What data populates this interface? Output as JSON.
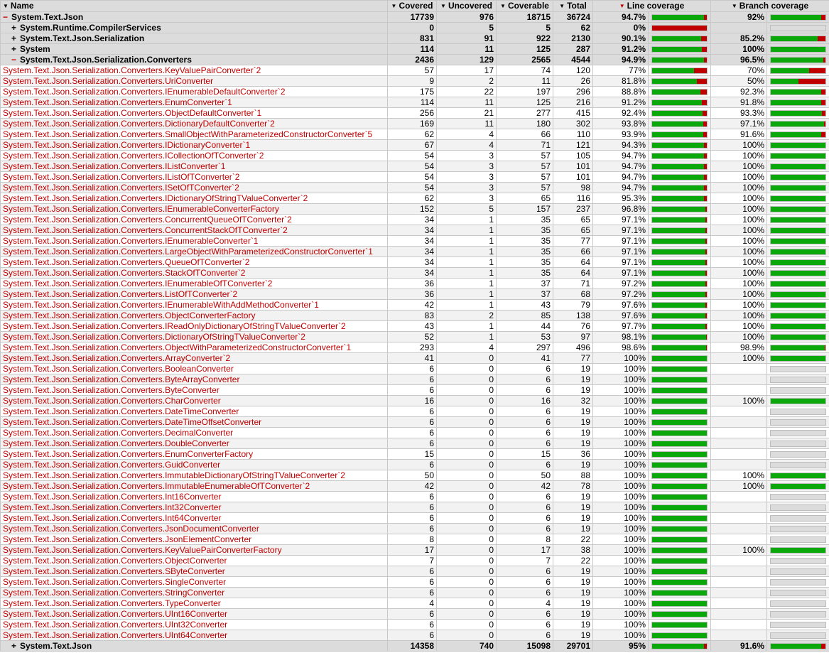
{
  "header": {
    "name": "Name",
    "covered": "Covered",
    "uncovered": "Uncovered",
    "coverable": "Coverable",
    "total": "Total",
    "line_coverage": "Line coverage",
    "branch_coverage": "Branch coverage"
  },
  "colors": {
    "covered": "#0aa80a",
    "uncovered": "#c00000"
  },
  "rows": [
    {
      "type": "group",
      "toggle": "−",
      "name": "System.Text.Json",
      "covered": "17739",
      "uncovered": "976",
      "coverable": "18715",
      "total": "36724",
      "line": "94.7%",
      "branch": "92%"
    },
    {
      "type": "group",
      "toggle": "+",
      "indent": true,
      "name": "System.Runtime.CompilerServices",
      "covered": "0",
      "uncovered": "5",
      "coverable": "5",
      "total": "62",
      "line": "0%",
      "branch": ""
    },
    {
      "type": "group",
      "toggle": "+",
      "indent": true,
      "name": "System.Text.Json.Serialization",
      "covered": "831",
      "uncovered": "91",
      "coverable": "922",
      "total": "2130",
      "line": "90.1%",
      "branch": "85.2%"
    },
    {
      "type": "group",
      "toggle": "+",
      "indent": true,
      "name": "System",
      "covered": "114",
      "uncovered": "11",
      "coverable": "125",
      "total": "287",
      "line": "91.2%",
      "branch": "100%"
    },
    {
      "type": "group",
      "toggle": "−",
      "indent": true,
      "name": "System.Text.Json.Serialization.Converters",
      "covered": "2436",
      "uncovered": "129",
      "coverable": "2565",
      "total": "4544",
      "line": "94.9%",
      "branch": "96.5%"
    },
    {
      "type": "child",
      "name": "System.Text.Json.Serialization.Converters.KeyValuePairConverter`2",
      "covered": "57",
      "uncovered": "17",
      "coverable": "74",
      "total": "120",
      "line": "77%",
      "branch": "70%"
    },
    {
      "type": "child",
      "name": "System.Text.Json.Serialization.Converters.UriConverter",
      "covered": "9",
      "uncovered": "2",
      "coverable": "11",
      "total": "26",
      "line": "81.8%",
      "branch": "50%"
    },
    {
      "type": "child",
      "name": "System.Text.Json.Serialization.Converters.IEnumerableDefaultConverter`2",
      "covered": "175",
      "uncovered": "22",
      "coverable": "197",
      "total": "296",
      "line": "88.8%",
      "branch": "92.3%"
    },
    {
      "type": "child",
      "name": "System.Text.Json.Serialization.Converters.EnumConverter`1",
      "covered": "114",
      "uncovered": "11",
      "coverable": "125",
      "total": "216",
      "line": "91.2%",
      "branch": "91.8%"
    },
    {
      "type": "child",
      "name": "System.Text.Json.Serialization.Converters.ObjectDefaultConverter`1",
      "covered": "256",
      "uncovered": "21",
      "coverable": "277",
      "total": "415",
      "line": "92.4%",
      "branch": "93.3%"
    },
    {
      "type": "child",
      "name": "System.Text.Json.Serialization.Converters.DictionaryDefaultConverter`2",
      "covered": "169",
      "uncovered": "11",
      "coverable": "180",
      "total": "302",
      "line": "93.8%",
      "branch": "97.1%"
    },
    {
      "type": "child",
      "name": "System.Text.Json.Serialization.Converters.SmallObjectWithParameterizedConstructorConverter`5",
      "covered": "62",
      "uncovered": "4",
      "coverable": "66",
      "total": "110",
      "line": "93.9%",
      "branch": "91.6%"
    },
    {
      "type": "child",
      "name": "System.Text.Json.Serialization.Converters.IDictionaryConverter`1",
      "covered": "67",
      "uncovered": "4",
      "coverable": "71",
      "total": "121",
      "line": "94.3%",
      "branch": "100%"
    },
    {
      "type": "child",
      "name": "System.Text.Json.Serialization.Converters.ICollectionOfTConverter`2",
      "covered": "54",
      "uncovered": "3",
      "coverable": "57",
      "total": "105",
      "line": "94.7%",
      "branch": "100%"
    },
    {
      "type": "child",
      "name": "System.Text.Json.Serialization.Converters.IListConverter`1",
      "covered": "54",
      "uncovered": "3",
      "coverable": "57",
      "total": "101",
      "line": "94.7%",
      "branch": "100%"
    },
    {
      "type": "child",
      "name": "System.Text.Json.Serialization.Converters.IListOfTConverter`2",
      "covered": "54",
      "uncovered": "3",
      "coverable": "57",
      "total": "101",
      "line": "94.7%",
      "branch": "100%"
    },
    {
      "type": "child",
      "name": "System.Text.Json.Serialization.Converters.ISetOfTConverter`2",
      "covered": "54",
      "uncovered": "3",
      "coverable": "57",
      "total": "98",
      "line": "94.7%",
      "branch": "100%"
    },
    {
      "type": "child",
      "name": "System.Text.Json.Serialization.Converters.IDictionaryOfStringTValueConverter`2",
      "covered": "62",
      "uncovered": "3",
      "coverable": "65",
      "total": "116",
      "line": "95.3%",
      "branch": "100%"
    },
    {
      "type": "child",
      "name": "System.Text.Json.Serialization.Converters.IEnumerableConverterFactory",
      "covered": "152",
      "uncovered": "5",
      "coverable": "157",
      "total": "237",
      "line": "96.8%",
      "branch": "100%"
    },
    {
      "type": "child",
      "name": "System.Text.Json.Serialization.Converters.ConcurrentQueueOfTConverter`2",
      "covered": "34",
      "uncovered": "1",
      "coverable": "35",
      "total": "65",
      "line": "97.1%",
      "branch": "100%"
    },
    {
      "type": "child",
      "name": "System.Text.Json.Serialization.Converters.ConcurrentStackOfTConverter`2",
      "covered": "34",
      "uncovered": "1",
      "coverable": "35",
      "total": "65",
      "line": "97.1%",
      "branch": "100%"
    },
    {
      "type": "child",
      "name": "System.Text.Json.Serialization.Converters.IEnumerableConverter`1",
      "covered": "34",
      "uncovered": "1",
      "coverable": "35",
      "total": "77",
      "line": "97.1%",
      "branch": "100%"
    },
    {
      "type": "child",
      "name": "System.Text.Json.Serialization.Converters.LargeObjectWithParameterizedConstructorConverter`1",
      "covered": "34",
      "uncovered": "1",
      "coverable": "35",
      "total": "66",
      "line": "97.1%",
      "branch": "100%"
    },
    {
      "type": "child",
      "name": "System.Text.Json.Serialization.Converters.QueueOfTConverter`2",
      "covered": "34",
      "uncovered": "1",
      "coverable": "35",
      "total": "64",
      "line": "97.1%",
      "branch": "100%"
    },
    {
      "type": "child",
      "name": "System.Text.Json.Serialization.Converters.StackOfTConverter`2",
      "covered": "34",
      "uncovered": "1",
      "coverable": "35",
      "total": "64",
      "line": "97.1%",
      "branch": "100%"
    },
    {
      "type": "child",
      "name": "System.Text.Json.Serialization.Converters.IEnumerableOfTConverter`2",
      "covered": "36",
      "uncovered": "1",
      "coverable": "37",
      "total": "71",
      "line": "97.2%",
      "branch": "100%"
    },
    {
      "type": "child",
      "name": "System.Text.Json.Serialization.Converters.ListOfTConverter`2",
      "covered": "36",
      "uncovered": "1",
      "coverable": "37",
      "total": "68",
      "line": "97.2%",
      "branch": "100%"
    },
    {
      "type": "child",
      "name": "System.Text.Json.Serialization.Converters.IEnumerableWithAddMethodConverter`1",
      "covered": "42",
      "uncovered": "1",
      "coverable": "43",
      "total": "79",
      "line": "97.6%",
      "branch": "100%"
    },
    {
      "type": "child",
      "name": "System.Text.Json.Serialization.Converters.ObjectConverterFactory",
      "covered": "83",
      "uncovered": "2",
      "coverable": "85",
      "total": "138",
      "line": "97.6%",
      "branch": "100%"
    },
    {
      "type": "child",
      "name": "System.Text.Json.Serialization.Converters.IReadOnlyDictionaryOfStringTValueConverter`2",
      "covered": "43",
      "uncovered": "1",
      "coverable": "44",
      "total": "76",
      "line": "97.7%",
      "branch": "100%"
    },
    {
      "type": "child",
      "name": "System.Text.Json.Serialization.Converters.DictionaryOfStringTValueConverter`2",
      "covered": "52",
      "uncovered": "1",
      "coverable": "53",
      "total": "97",
      "line": "98.1%",
      "branch": "100%"
    },
    {
      "type": "child",
      "name": "System.Text.Json.Serialization.Converters.ObjectWithParameterizedConstructorConverter`1",
      "covered": "293",
      "uncovered": "4",
      "coverable": "297",
      "total": "496",
      "line": "98.6%",
      "branch": "98.9%"
    },
    {
      "type": "child",
      "name": "System.Text.Json.Serialization.Converters.ArrayConverter`2",
      "covered": "41",
      "uncovered": "0",
      "coverable": "41",
      "total": "77",
      "line": "100%",
      "branch": "100%"
    },
    {
      "type": "child",
      "name": "System.Text.Json.Serialization.Converters.BooleanConverter",
      "covered": "6",
      "uncovered": "0",
      "coverable": "6",
      "total": "19",
      "line": "100%",
      "branch": ""
    },
    {
      "type": "child",
      "name": "System.Text.Json.Serialization.Converters.ByteArrayConverter",
      "covered": "6",
      "uncovered": "0",
      "coverable": "6",
      "total": "19",
      "line": "100%",
      "branch": ""
    },
    {
      "type": "child",
      "name": "System.Text.Json.Serialization.Converters.ByteConverter",
      "covered": "6",
      "uncovered": "0",
      "coverable": "6",
      "total": "19",
      "line": "100%",
      "branch": ""
    },
    {
      "type": "child",
      "name": "System.Text.Json.Serialization.Converters.CharConverter",
      "covered": "16",
      "uncovered": "0",
      "coverable": "16",
      "total": "32",
      "line": "100%",
      "branch": "100%"
    },
    {
      "type": "child",
      "name": "System.Text.Json.Serialization.Converters.DateTimeConverter",
      "covered": "6",
      "uncovered": "0",
      "coverable": "6",
      "total": "19",
      "line": "100%",
      "branch": ""
    },
    {
      "type": "child",
      "name": "System.Text.Json.Serialization.Converters.DateTimeOffsetConverter",
      "covered": "6",
      "uncovered": "0",
      "coverable": "6",
      "total": "19",
      "line": "100%",
      "branch": ""
    },
    {
      "type": "child",
      "name": "System.Text.Json.Serialization.Converters.DecimalConverter",
      "covered": "6",
      "uncovered": "0",
      "coverable": "6",
      "total": "19",
      "line": "100%",
      "branch": ""
    },
    {
      "type": "child",
      "name": "System.Text.Json.Serialization.Converters.DoubleConverter",
      "covered": "6",
      "uncovered": "0",
      "coverable": "6",
      "total": "19",
      "line": "100%",
      "branch": ""
    },
    {
      "type": "child",
      "name": "System.Text.Json.Serialization.Converters.EnumConverterFactory",
      "covered": "15",
      "uncovered": "0",
      "coverable": "15",
      "total": "36",
      "line": "100%",
      "branch": ""
    },
    {
      "type": "child",
      "name": "System.Text.Json.Serialization.Converters.GuidConverter",
      "covered": "6",
      "uncovered": "0",
      "coverable": "6",
      "total": "19",
      "line": "100%",
      "branch": ""
    },
    {
      "type": "child",
      "name": "System.Text.Json.Serialization.Converters.ImmutableDictionaryOfStringTValueConverter`2",
      "covered": "50",
      "uncovered": "0",
      "coverable": "50",
      "total": "88",
      "line": "100%",
      "branch": "100%"
    },
    {
      "type": "child",
      "name": "System.Text.Json.Serialization.Converters.ImmutableEnumerableOfTConverter`2",
      "covered": "42",
      "uncovered": "0",
      "coverable": "42",
      "total": "78",
      "line": "100%",
      "branch": "100%"
    },
    {
      "type": "child",
      "name": "System.Text.Json.Serialization.Converters.Int16Converter",
      "covered": "6",
      "uncovered": "0",
      "coverable": "6",
      "total": "19",
      "line": "100%",
      "branch": ""
    },
    {
      "type": "child",
      "name": "System.Text.Json.Serialization.Converters.Int32Converter",
      "covered": "6",
      "uncovered": "0",
      "coverable": "6",
      "total": "19",
      "line": "100%",
      "branch": ""
    },
    {
      "type": "child",
      "name": "System.Text.Json.Serialization.Converters.Int64Converter",
      "covered": "6",
      "uncovered": "0",
      "coverable": "6",
      "total": "19",
      "line": "100%",
      "branch": ""
    },
    {
      "type": "child",
      "name": "System.Text.Json.Serialization.Converters.JsonDocumentConverter",
      "covered": "6",
      "uncovered": "0",
      "coverable": "6",
      "total": "19",
      "line": "100%",
      "branch": ""
    },
    {
      "type": "child",
      "name": "System.Text.Json.Serialization.Converters.JsonElementConverter",
      "covered": "8",
      "uncovered": "0",
      "coverable": "8",
      "total": "22",
      "line": "100%",
      "branch": ""
    },
    {
      "type": "child",
      "name": "System.Text.Json.Serialization.Converters.KeyValuePairConverterFactory",
      "covered": "17",
      "uncovered": "0",
      "coverable": "17",
      "total": "38",
      "line": "100%",
      "branch": "100%"
    },
    {
      "type": "child",
      "name": "System.Text.Json.Serialization.Converters.ObjectConverter",
      "covered": "7",
      "uncovered": "0",
      "coverable": "7",
      "total": "22",
      "line": "100%",
      "branch": ""
    },
    {
      "type": "child",
      "name": "System.Text.Json.Serialization.Converters.SByteConverter",
      "covered": "6",
      "uncovered": "0",
      "coverable": "6",
      "total": "19",
      "line": "100%",
      "branch": ""
    },
    {
      "type": "child",
      "name": "System.Text.Json.Serialization.Converters.SingleConverter",
      "covered": "6",
      "uncovered": "0",
      "coverable": "6",
      "total": "19",
      "line": "100%",
      "branch": ""
    },
    {
      "type": "child",
      "name": "System.Text.Json.Serialization.Converters.StringConverter",
      "covered": "6",
      "uncovered": "0",
      "coverable": "6",
      "total": "19",
      "line": "100%",
      "branch": ""
    },
    {
      "type": "child",
      "name": "System.Text.Json.Serialization.Converters.TypeConverter",
      "covered": "4",
      "uncovered": "0",
      "coverable": "4",
      "total": "19",
      "line": "100%",
      "branch": ""
    },
    {
      "type": "child",
      "name": "System.Text.Json.Serialization.Converters.UInt16Converter",
      "covered": "6",
      "uncovered": "0",
      "coverable": "6",
      "total": "19",
      "line": "100%",
      "branch": ""
    },
    {
      "type": "child",
      "name": "System.Text.Json.Serialization.Converters.UInt32Converter",
      "covered": "6",
      "uncovered": "0",
      "coverable": "6",
      "total": "19",
      "line": "100%",
      "branch": ""
    },
    {
      "type": "child",
      "name": "System.Text.Json.Serialization.Converters.UInt64Converter",
      "covered": "6",
      "uncovered": "0",
      "coverable": "6",
      "total": "19",
      "line": "100%",
      "branch": ""
    },
    {
      "type": "group",
      "toggle": "+",
      "indent": true,
      "name": "System.Text.Json",
      "covered": "14358",
      "uncovered": "740",
      "coverable": "15098",
      "total": "29701",
      "line": "95%",
      "branch": "91.6%"
    }
  ]
}
